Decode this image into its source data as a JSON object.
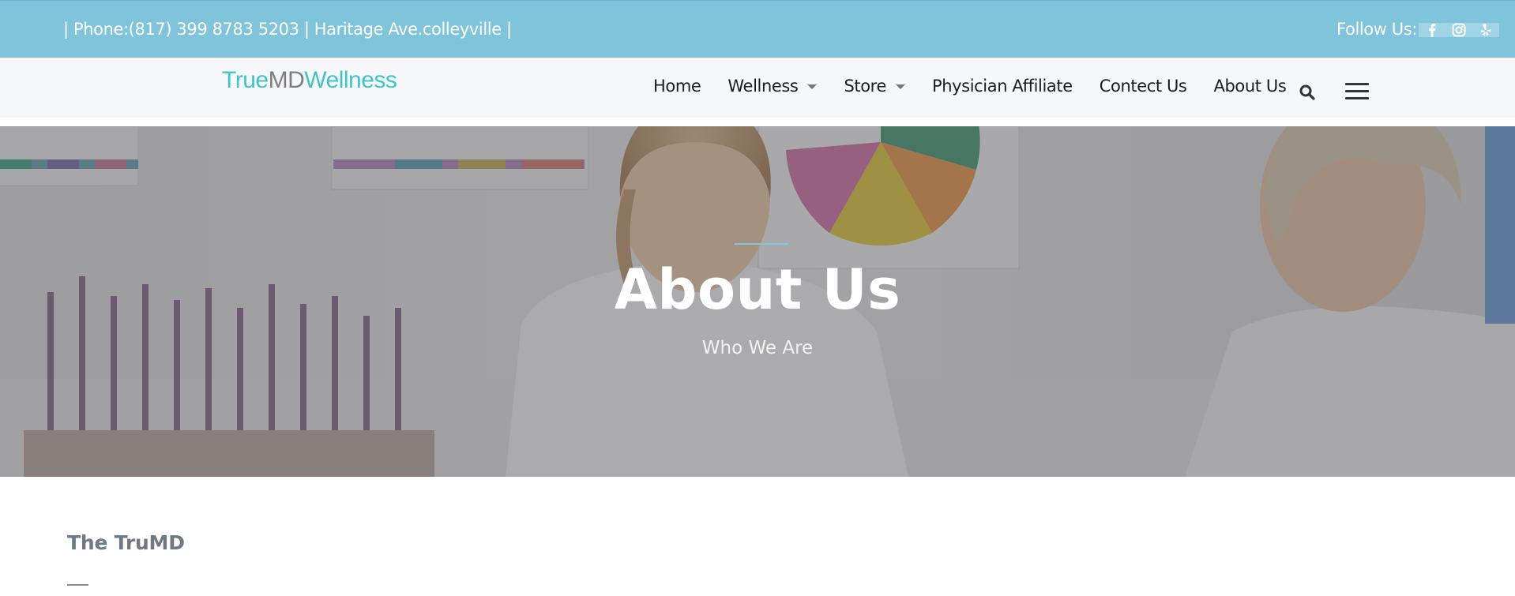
{
  "topbar": {
    "contact_text": "| Phone:(817) 399 8783 5203 | Haritage Ave.colleyville |",
    "follow_label": "Follow Us:",
    "social": [
      {
        "icon": "facebook-icon"
      },
      {
        "icon": "instagram-icon"
      },
      {
        "icon": "yelp-icon"
      }
    ]
  },
  "logo": {
    "part1": "True",
    "part2": "MD",
    "part3": "Wellness"
  },
  "nav": {
    "items": [
      {
        "label": "Home",
        "dropdown": false
      },
      {
        "label": "Wellness",
        "dropdown": true
      },
      {
        "label": "Store",
        "dropdown": true
      },
      {
        "label": "Physician Affiliate",
        "dropdown": false
      },
      {
        "label": "Contect Us",
        "dropdown": false
      },
      {
        "label": "About Us",
        "dropdown": false
      }
    ],
    "search_icon": "search-icon",
    "menu_icon": "hamburger-menu-icon"
  },
  "hero": {
    "title": "About Us",
    "subtitle": "Who We Are"
  },
  "content": {
    "section_title": "The TruMD"
  },
  "colors": {
    "topbar_bg": "#80c4dc",
    "brand_teal": "#40c4c9",
    "brand_gray": "#7d7d7d",
    "accent_rule": "#86c6dc"
  }
}
